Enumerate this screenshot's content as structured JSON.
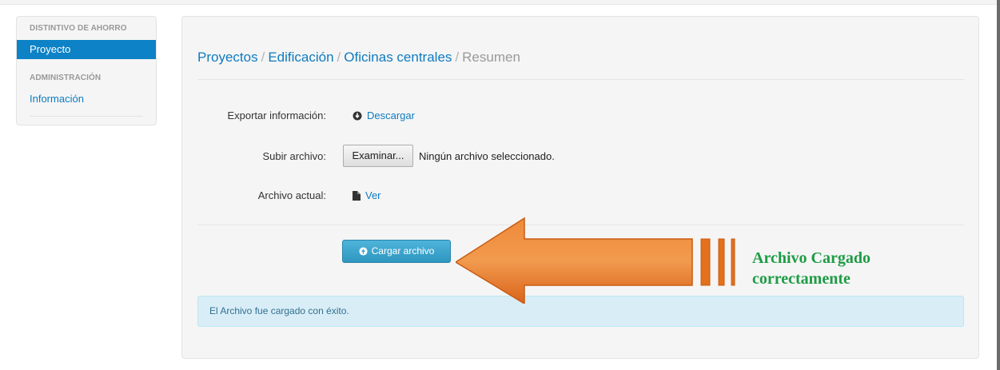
{
  "sidebar": {
    "section1_header": "DISTINTIVO DE AHORRO",
    "active_item": "Proyecto",
    "section2_header": "ADMINISTRACIÓN",
    "link_item": "Información"
  },
  "breadcrumb": {
    "items": [
      "Proyectos",
      "Edificación",
      "Oficinas centrales"
    ],
    "separator": "/",
    "current": "Resumen"
  },
  "form": {
    "export_label": "Exportar información:",
    "export_link": "Descargar",
    "upload_label": "Subir archivo:",
    "browse_button": "Examinar...",
    "file_status": "Ningún archivo seleccionado.",
    "current_label": "Archivo actual:",
    "current_link": "Ver",
    "submit_button": "Cargar archivo"
  },
  "alert": {
    "message": "El Archivo fue cargado con éxito."
  },
  "annotation": {
    "line1": "Archivo Cargado",
    "line2": "correctamente",
    "arrow_color": "#e2711d",
    "text_color": "#1e9b45"
  },
  "icons": {
    "download": "circle-arrow-icon",
    "file": "file-icon",
    "upload": "circle-arrow-icon"
  },
  "colors": {
    "primary": "#0d82c7",
    "link": "#0f7bc0",
    "info_button": "#3fa7d0",
    "alert_bg": "#d9edf7"
  }
}
